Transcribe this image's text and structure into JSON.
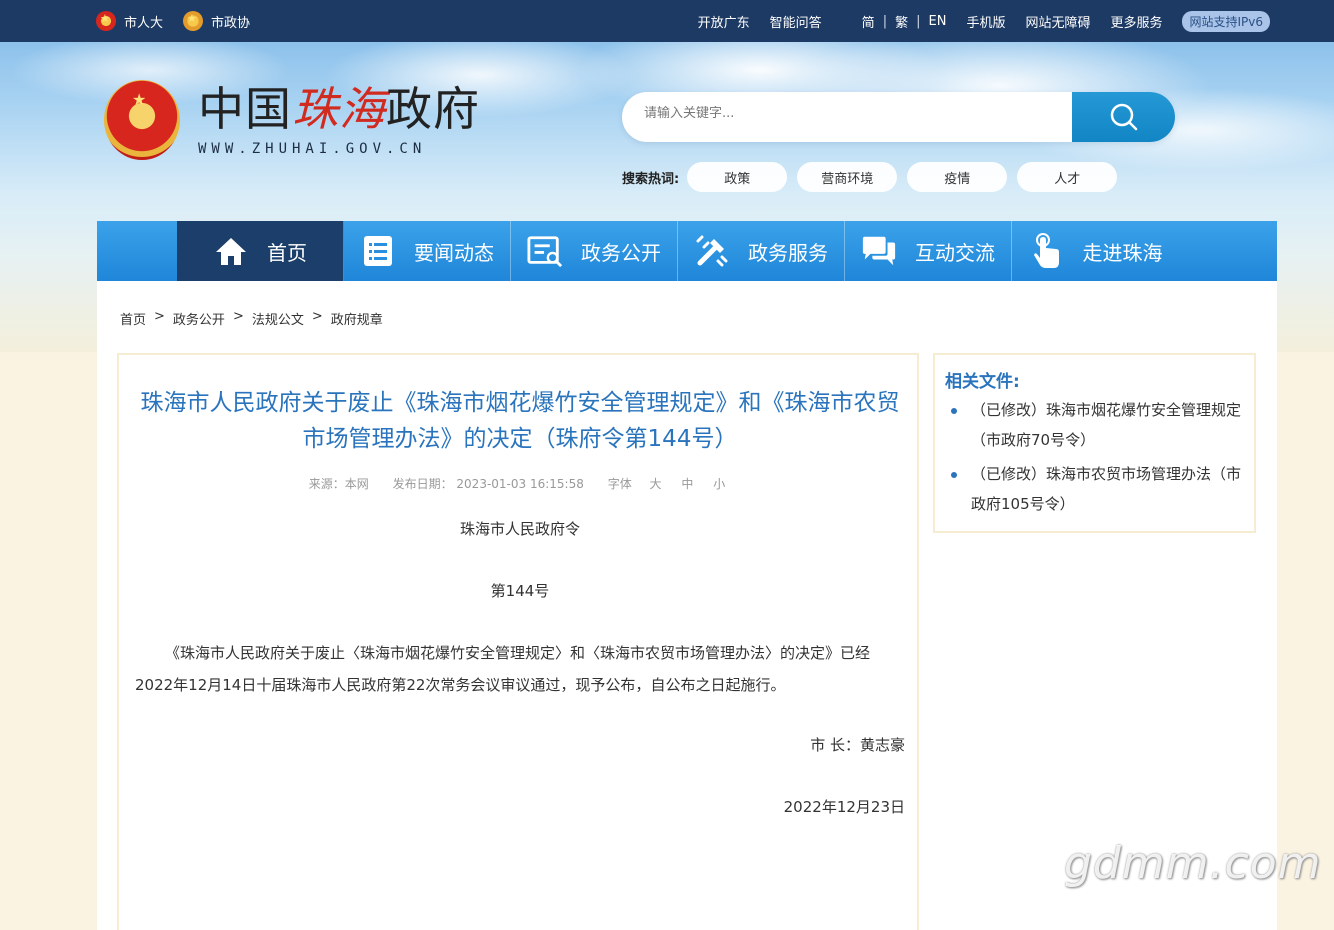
{
  "topbar": {
    "left_links": [
      {
        "label": "市人大",
        "icon": "emblem-icon"
      },
      {
        "label": "市政协",
        "icon": "cppcc-emblem-icon"
      }
    ],
    "right_links": [
      "开放广东",
      "智能问答"
    ],
    "languages": [
      "简",
      "繁",
      "EN"
    ],
    "extra_links": [
      "手机版",
      "网站无障碍",
      "更多服务"
    ],
    "ipv6_badge": "网站支持IPv6"
  },
  "logo": {
    "cn_prefix": "中国",
    "cn_city": "珠海",
    "cn_suffix": "政府",
    "en": "WWW.ZHUHAI.GOV.CN"
  },
  "search": {
    "placeholder": "请输入关键字...",
    "button_icon": "search-icon",
    "hot_label": "搜索热词:",
    "hot_tags": [
      "政策",
      "营商环境",
      "疫情",
      "人才"
    ]
  },
  "nav": [
    {
      "label": "首页",
      "icon": "home-icon",
      "active": true
    },
    {
      "label": "要闻动态",
      "icon": "news-list-icon"
    },
    {
      "label": "政务公开",
      "icon": "document-icon"
    },
    {
      "label": "政务服务",
      "icon": "tools-icon"
    },
    {
      "label": "互动交流",
      "icon": "chat-icon"
    },
    {
      "label": "走进珠海",
      "icon": "hand-pointer-icon"
    }
  ],
  "breadcrumb": [
    "首页",
    "政务公开",
    "法规公文",
    "政府规章"
  ],
  "breadcrumb_sep": ">",
  "article": {
    "title": "珠海市人民政府关于废止《珠海市烟花爆竹安全管理规定》和《珠海市农贸市场管理办法》的决定（珠府令第144号）",
    "meta": {
      "source": "来源：本网",
      "date": "发布日期：  2023-01-03 16:15:58",
      "font_label": "字体",
      "font_sizes": [
        "大",
        "中",
        "小"
      ]
    },
    "heading1": "珠海市人民政府令",
    "heading2": "第144号",
    "paragraph": "《珠海市人民政府关于废止〈珠海市烟花爆竹安全管理规定〉和〈珠海市农贸市场管理办法〉的决定》已经2022年12月14日十届珠海市人民政府第22次常务会议审议通过，现予公布，自公布之日起施行。",
    "signature": "市  长：黄志豪",
    "sign_date": "2022年12月23日"
  },
  "related": {
    "title": "相关文件:",
    "items": [
      "（已修改）珠海市烟花爆竹安全管理规定（市政府70号令）",
      "（已修改）珠海市农贸市场管理办法（市政府105号令）"
    ]
  },
  "watermark": "gdmm.com"
}
